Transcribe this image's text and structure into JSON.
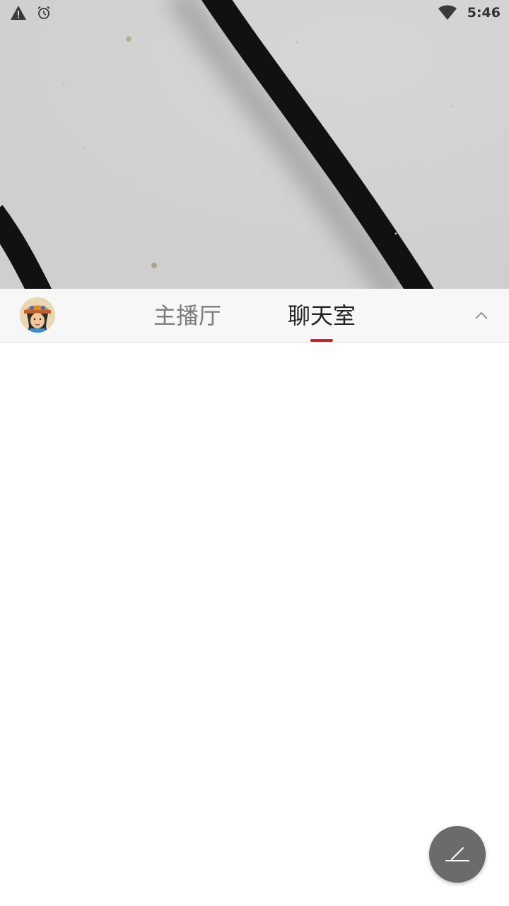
{
  "status_bar": {
    "time": "5:46",
    "icons": [
      "warning-icon",
      "alarm-icon",
      "wifi-icon"
    ]
  },
  "hero": {
    "description_icon": "background-photo"
  },
  "tabs": [
    {
      "label": "主播厅",
      "active": false
    },
    {
      "label": "聊天室",
      "active": true
    }
  ],
  "header": {
    "avatar": "user-avatar",
    "collapse_icon": "chevron-up-icon"
  },
  "fab": {
    "icon": "edit-icon"
  },
  "colors": {
    "accent": "#d81e2c",
    "tab_active": "#222222",
    "tab_inactive": "#7b7b7b",
    "fab_bg": "#6b6b6b"
  }
}
